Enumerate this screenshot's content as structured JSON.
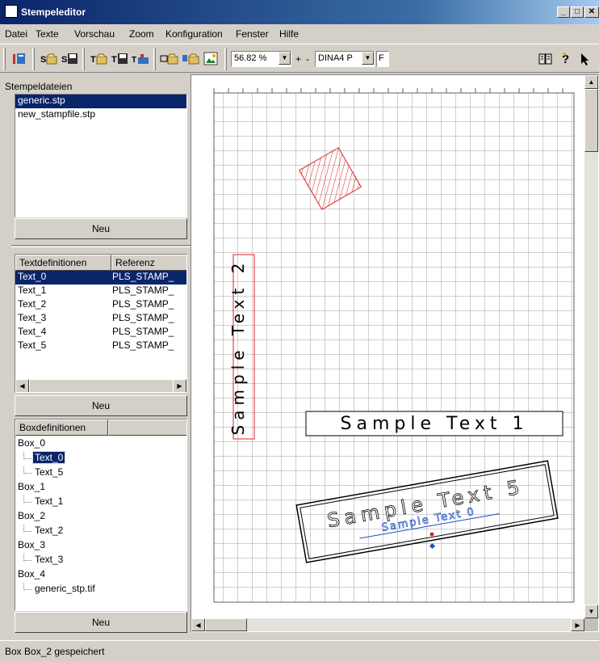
{
  "window": {
    "title": "Stempeleditor"
  },
  "menu": [
    "Datei",
    "Texte",
    "Vorschau",
    "Zoom",
    "Konfiguration",
    "Fenster",
    "Hilfe"
  ],
  "toolbar": {
    "zoom_value": "56.82 %",
    "zoom_plus": "+",
    "zoom_minus": "-",
    "paper_value": "DINA4 P",
    "f_label": "F"
  },
  "stamp_files": {
    "label": "Stempeldateien",
    "items": [
      "generic.stp",
      "new_stampfile.stp"
    ],
    "new_button": "Neu"
  },
  "text_defs": {
    "columns": [
      "Textdefinitionen",
      "Referenz"
    ],
    "rows": [
      {
        "name": "Text_0",
        "ref": "PLS_STAMP_"
      },
      {
        "name": "Text_1",
        "ref": "PLS_STAMP_"
      },
      {
        "name": "Text_2",
        "ref": "PLS_STAMP_"
      },
      {
        "name": "Text_3",
        "ref": "PLS_STAMP_"
      },
      {
        "name": "Text_4",
        "ref": "PLS_STAMP_"
      },
      {
        "name": "Text_5",
        "ref": "PLS_STAMP_"
      }
    ],
    "new_button": "Neu"
  },
  "box_defs": {
    "column": "Boxdefinitionen",
    "tree": [
      {
        "label": "Box_0",
        "level": 0
      },
      {
        "label": "Text_0",
        "level": 1,
        "selected": true
      },
      {
        "label": "Text_5",
        "level": 1
      },
      {
        "label": "Box_1",
        "level": 0
      },
      {
        "label": "Text_1",
        "level": 1
      },
      {
        "label": "Box_2",
        "level": 0
      },
      {
        "label": "Text_2",
        "level": 1
      },
      {
        "label": "Box_3",
        "level": 0
      },
      {
        "label": "Text_3",
        "level": 1
      },
      {
        "label": "Box_4",
        "level": 0
      },
      {
        "label": "generic_stp.tif",
        "level": 1
      }
    ],
    "new_button": "Neu"
  },
  "canvas": {
    "vertical_text": "Sample Text 2",
    "box_text_1": "Sample Text 1",
    "rotated_text_5": "Sample Text 5",
    "rotated_text_0": "Sample Text 0",
    "colors": {
      "selection": "#0a246a",
      "red_shape": "#e02020",
      "blue_text": "#2050c0"
    }
  },
  "status": {
    "text": "Box Box_2 gespeichert"
  }
}
